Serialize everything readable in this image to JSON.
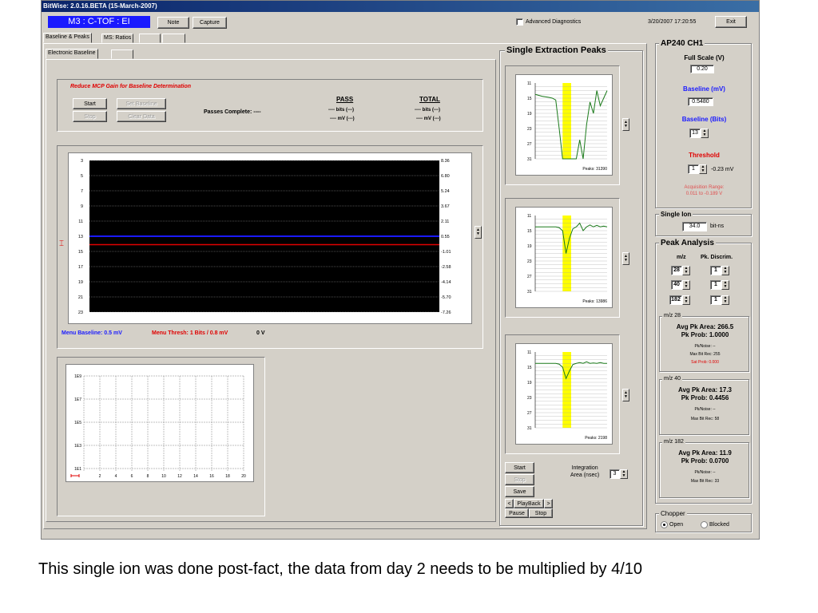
{
  "window": {
    "title": "BitWise: 2.0.16.BETA (15-March-2007)",
    "mode_label": "M3 : C-TOF : EI",
    "note_label": "Note",
    "capture_label": "Capture",
    "advanced_diag_label": "Advanced Diagnostics",
    "advanced_diag_checked": false,
    "datetime": "3/20/2007 17:20:55",
    "exit_label": "Exit"
  },
  "tabs": [
    {
      "label": "Baseline & Peaks",
      "active": true
    },
    {
      "label": "MS: Ratios",
      "active": false
    },
    {
      "label": "",
      "active": false
    },
    {
      "label": "",
      "active": false
    }
  ],
  "subtabs": [
    {
      "label": "Electronic Baseline",
      "active": true
    },
    {
      "label": "",
      "active": false
    }
  ],
  "baseline": {
    "warning": "Reduce MCP Gain for Baseline Determination",
    "start_label": "Start",
    "stop_label": "Stop",
    "set_baseline_label": "Set Baseline",
    "clear_data_label": "Clear Data",
    "passes_label": "Passes Complete: ----",
    "pass_header": "PASS",
    "total_header": "TOTAL",
    "pass_bits": "---- bits (---)",
    "pass_mv": "---- mV (---)",
    "total_bits": "---- bits (---)",
    "total_mv": "---- mV (---)"
  },
  "heatmap": {
    "left_ticks": [
      "3",
      "5",
      "7",
      "9",
      "11",
      "13",
      "15",
      "17",
      "19",
      "21",
      "23"
    ],
    "right_ticks": [
      "8.36",
      "6.80",
      "5.24",
      "3.67",
      "2.11",
      "0.55",
      "-1.01",
      "-2.58",
      "-4.14",
      "-5.70",
      "-7.26"
    ],
    "baseline_color": "#1a1aff",
    "threshold_color": "#e00000",
    "menu_baseline": "Menu Baseline: 0.5 mV",
    "menu_thresh": "Menu Thresh: 1 Bits / 0.8 mV",
    "zero_v": "0 V"
  },
  "log_chart": {
    "y_ticks": [
      "1E9",
      "1E7",
      "1E5",
      "1E3",
      "1E1"
    ],
    "x_ticks": [
      "2",
      "4",
      "6",
      "8",
      "10",
      "12",
      "14",
      "16",
      "18",
      "20"
    ]
  },
  "single_extraction": {
    "title": "Single Extraction Peaks",
    "peaks": [
      {
        "label": "Peaks: 31390",
        "y_ticks": [
          "11",
          "15",
          "19",
          "23",
          "27",
          "31"
        ],
        "chart_data": {
          "type": "line",
          "x": [
            0,
            4,
            8,
            10,
            12,
            14,
            16,
            18,
            20,
            22,
            24,
            26,
            28,
            30,
            32,
            34,
            36,
            38,
            40,
            42
          ],
          "y": [
            14,
            14.5,
            14.8,
            15,
            15.5,
            23,
            31,
            31,
            31,
            31,
            31,
            26,
            31,
            22,
            16,
            19,
            13,
            17,
            15,
            13
          ],
          "ylim": [
            31,
            11
          ]
        }
      },
      {
        "label": "Peaks: 13986",
        "y_ticks": [
          "11",
          "15",
          "19",
          "23",
          "27",
          "31"
        ],
        "chart_data": {
          "type": "line",
          "x": [
            0,
            4,
            8,
            12,
            14,
            16,
            18,
            20,
            22,
            24,
            26,
            28,
            30,
            32,
            34,
            36,
            38,
            40,
            42
          ],
          "y": [
            14,
            14,
            14,
            14,
            14.2,
            15,
            21,
            17,
            14.5,
            14,
            13,
            15,
            14,
            13.5,
            14,
            13.6,
            14,
            13.8,
            14
          ],
          "ylim": [
            31,
            11
          ]
        }
      },
      {
        "label": "Peaks: 2198",
        "y_ticks": [
          "11",
          "15",
          "19",
          "23",
          "27",
          "31"
        ],
        "chart_data": {
          "type": "line",
          "x": [
            0,
            4,
            8,
            12,
            14,
            16,
            18,
            20,
            22,
            24,
            26,
            28,
            30,
            32,
            34,
            36,
            38,
            40,
            42
          ],
          "y": [
            14,
            14,
            14,
            14,
            14.2,
            15,
            18,
            16,
            14.3,
            14,
            13.8,
            14,
            13.6,
            14,
            13.9,
            14,
            13.8,
            14,
            14
          ],
          "ylim": [
            31,
            11
          ]
        }
      }
    ],
    "start_label": "Start",
    "stop_label": "Stop",
    "save_label": "Save",
    "integration_label_1": "Integration",
    "integration_label_2": "Area (nsec)",
    "integration_value": "3",
    "prev_label": "<",
    "playback_label": "PlayBack",
    "next_label": ">",
    "pause_label": "Pause",
    "stop2_label": "Stop"
  },
  "ap240": {
    "title": "AP240 CH1",
    "full_scale_label": "Full Scale (V)",
    "full_scale_value": "0.20",
    "baseline_mv_label": "Baseline (mV)",
    "baseline_mv_value": "0.5480",
    "baseline_bits_label": "Baseline (Bits)",
    "baseline_bits_value": "13",
    "threshold_label": "Threshold",
    "threshold_value": "1",
    "threshold_mv": "-0.23 mV",
    "acq_range_1": "Acquisition Range:",
    "acq_range_2": "0.011 to -0.189 V"
  },
  "single_ion": {
    "title": "Single Ion",
    "value": "34.0",
    "unit": "bit-ns"
  },
  "peak_analysis": {
    "title": "Peak Analysis",
    "mz_header": "m/z",
    "discrim_header": "Pk. Discrim.",
    "rows": [
      {
        "mz": "28",
        "discrim": "1"
      },
      {
        "mz": "40",
        "discrim": "1"
      },
      {
        "mz": "182",
        "discrim": "1"
      }
    ],
    "groups": [
      {
        "title": "m/z 28",
        "avg": "Avg Pk Area: 266.5",
        "prob": "Pk Prob: 1.0000",
        "noise": "Pk/Noise: --",
        "max": "Max Bit Rec: 255",
        "sat": "Sat Prob: 0.000"
      },
      {
        "title": "m/z 40",
        "avg": "Avg Pk Area: 17.3",
        "prob": "Pk Prob: 0.4456",
        "noise": "Pk/Noise: --",
        "max": "Max Bit Rec: 58",
        "sat": ""
      },
      {
        "title": "m/z 182",
        "avg": "Avg Pk Area: 11.9",
        "prob": "Pk Prob: 0.0700",
        "noise": "Pk/Noise: --",
        "max": "Max Bit Rec: 33",
        "sat": ""
      }
    ]
  },
  "chopper": {
    "title": "Chopper",
    "open_label": "Open",
    "blocked_label": "Blocked",
    "selected": "Open"
  },
  "caption": "This single ion was done post-fact, the data from day 2 needs to be multiplied by 4/10"
}
